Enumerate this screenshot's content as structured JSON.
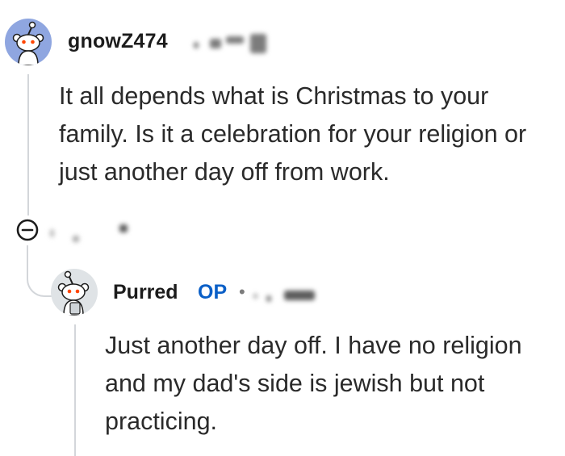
{
  "comments": [
    {
      "username": "gnowZ474",
      "body": "It all depends what is Christmas to your family. Is it a celebration for your religion or just another day off from work.",
      "avatar_icon": "snoo-avatar-icon",
      "avatar_color": "#8fa6e0"
    },
    {
      "username": "Purred",
      "badge": "OP",
      "separator": "•",
      "body": "Just another day off. I have no religion and my dad's side is jewish but not practicing.",
      "avatar_icon": "snoo-avatar-icon",
      "avatar_color": "#dfe3e6",
      "badge_color": "#0a5fc7"
    }
  ],
  "controls": {
    "collapse_icon": "collapse-minus-icon"
  },
  "colors": {
    "thread_line": "#d3d6da",
    "text": "#2a2a2a"
  }
}
